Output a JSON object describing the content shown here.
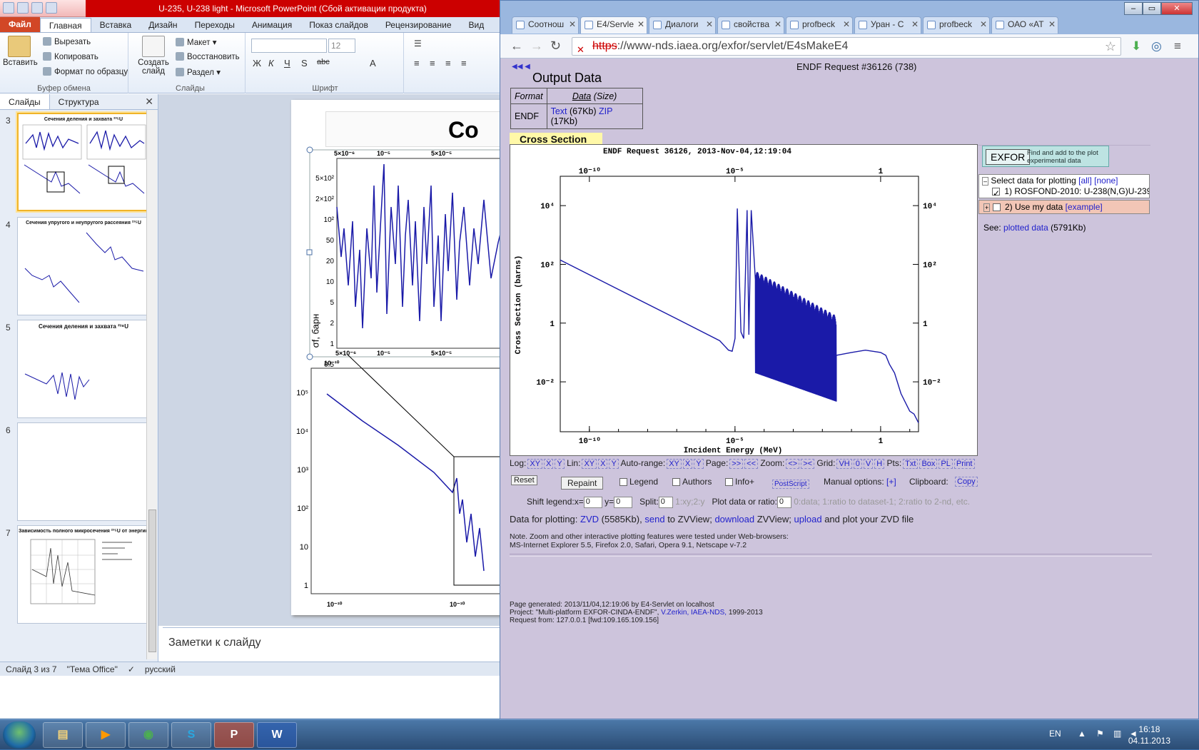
{
  "ppt": {
    "title": "U-235, U-238 light  -  Microsoft PowerPoint (Сбой активации продукта)",
    "tabs": [
      "Файл",
      "Главная",
      "Вставка",
      "Дизайн",
      "Переходы",
      "Анимация",
      "Показ слайдов",
      "Рецензирование",
      "Вид"
    ],
    "ribbon": {
      "paste": "Вставить",
      "cut": "Вырезать",
      "copy": "Копировать",
      "format_painter": "Формат по образцу",
      "clipboard_group": "Буфер обмена",
      "new_slide": "Создать слайд",
      "layout": "Макет",
      "reset": "Восстановить",
      "section": "Раздел",
      "slides_group": "Слайды",
      "font_size": "12",
      "font_group": "Шрифт"
    },
    "pane_tabs": [
      "Слайды",
      "Структура"
    ],
    "thumbs": [
      {
        "num": "3",
        "title": "Сечения деления и захвата ²³⁵U"
      },
      {
        "num": "4",
        "title": "Сечения упругого и неупругого рассеяния ²³⁵U"
      },
      {
        "num": "5",
        "title": "Сечения деления и захвата ²³⁸U"
      },
      {
        "num": "6",
        "title": ""
      },
      {
        "num": "7",
        "title": "Зависимость полного микросечения ²³⁵U от энергии"
      }
    ],
    "notes": "Заметки к слайду",
    "status": {
      "slide": "Слайд 3 из 7",
      "theme": "\"Тема Office\"",
      "lang": "русский"
    },
    "slide_axis": {
      "ylabel": "σf, барн",
      "yticks_top": [
        "5×10²",
        "2×10²",
        "10²",
        "50",
        "20",
        "10",
        "5",
        "2",
        "1",
        "0.5"
      ],
      "yticks_bottom": [
        "10⁵",
        "10⁴",
        "10³",
        "10²",
        "10",
        "1"
      ],
      "xticks": [
        "5×10⁻⁶",
        "10⁻⁵",
        "5×10⁻⁵"
      ],
      "xtick_low": "10⁻¹⁰"
    }
  },
  "chrome": {
    "tabs": [
      "Соотнош",
      "E4/Servle",
      "Диалоги",
      "свойства",
      "profbeck",
      "Уран - С",
      "profbeck",
      "ОАО «АТ"
    ],
    "url_scheme": "https",
    "url_rest": "://www-nds.iaea.org/exfor/servlet/E4sMakeE4"
  },
  "page": {
    "request_title": "ENDF Request #36126 (738)",
    "output_heading": "Output Data",
    "table": {
      "h_format": "Format",
      "h_data": "Data",
      "h_size": "(Size)",
      "format": "ENDF",
      "text_link": "Text",
      "text_size": "(67Kb)",
      "zip_link": "ZIP",
      "zip_size": "(17Kb)"
    },
    "cross_section_label": "Cross Section",
    "exfor_button": "EXFOR",
    "exfor_hint": "Find and add to the plot experimental data",
    "select_label": "Select data for plotting",
    "select_all": "[all]",
    "select_none": "[none]",
    "dataset1": "1) ROSFOND-2010: U-238(N,G)U-239",
    "use_my_data": "2) Use my data",
    "example": "[example]",
    "see": "See:",
    "plotted_data": "plotted data",
    "plotted_size": "(5791Kb)",
    "controls": {
      "log": "Log:",
      "lin": "Lin:",
      "autorange": "Auto-range:",
      "page": "Page:",
      "zoom": "Zoom:",
      "grid": "Grid:",
      "pts": "Pts:",
      "xy": "XY",
      "x": "X",
      "y": "Y",
      "next": ">>",
      "prev": "<<",
      "zin": "<>",
      "zout": "><",
      "vh": "VH",
      "zero": "0",
      "v": "V",
      "h": "H",
      "txt": "Txt",
      "box": "Box",
      "pl": "PL",
      "print": "Print",
      "reset": "Reset",
      "repaint": "Repaint",
      "legend": "Legend",
      "authors": "Authors",
      "info": "Info+",
      "postscript": "PostScript",
      "manual": "Manual options:",
      "manual_link": "[+]",
      "clipboard": "Clipboard:",
      "copy": "Copy",
      "shift_legend": "Shift legend:x=",
      "y_eq": "y=",
      "split": "Split:",
      "split_hint": "1:xy;2:y",
      "ratio": "Plot data or ratio:",
      "ratio_hint": "0:data; 1:ratio to dataset-1; 2:ratio to 2-nd, etc.",
      "shift_x": "0",
      "shift_y": "0",
      "split_val": "0",
      "ratio_val": "0"
    },
    "data_line": {
      "prefix": "Data for plotting:",
      "zvd": "ZVD",
      "zvd_size": "(5585Kb),",
      "send": "send",
      "to_zview": "to ZVView;",
      "download": "download",
      "zview": "ZVView;",
      "upload": "upload",
      "tail": "and plot your ZVD file"
    },
    "note1": "Note. Zoom and other interactive plotting features were tested under Web-browsers:",
    "note2": "MS-Internet Explorer 5.5, Firefox 2.0, Safari, Opera 9.1, Netscape v-7.2",
    "gen1": "Page generated: 2013/11/04,12:19:06 by E4-Servlet on localhost",
    "gen2_a": "Project: \"Multi-platform EXFOR-CINDA-ENDF\",",
    "gen2_b": "V.Zerkin, IAEA-NDS,",
    "gen2_c": "1999-2013",
    "gen3": "Request from: 127.0.0.1 [fwd:109.165.109.156]"
  },
  "chart_data": {
    "type": "line",
    "title": "ENDF Request 36126, 2013-Nov-04,12:19:04",
    "xlabel": "Incident Energy (MeV)",
    "ylabel": "Cross Section (barns)",
    "x_scale": "log",
    "y_scale": "log",
    "xlim": [
      1e-11,
      20
    ],
    "ylim": [
      0.0002,
      100000
    ],
    "xticks": [
      "10⁻¹⁰",
      "10⁻⁵",
      "1"
    ],
    "yticks": [
      "10⁴",
      "10²",
      "1",
      "10⁻²"
    ],
    "series": [
      {
        "name": "1) ROSFOND-2010: U-238(N,G)U-239",
        "color": "#1a1aa8",
        "x": [
          1e-11,
          1e-09,
          1e-07,
          3e-06,
          6e-06,
          8e-06,
          1e-05,
          1.2e-05,
          1.6e-05,
          2e-05,
          2.6e-05,
          3e-05,
          3.6e-05,
          5e-05,
          0.0001,
          0.0003,
          0.001,
          0.003,
          0.01,
          0.03,
          0.1,
          0.3,
          1,
          1.5,
          2,
          3,
          5,
          10,
          14,
          20
        ],
        "y": [
          140,
          14,
          1.4,
          0.25,
          0.12,
          0.11,
          0.3,
          8000,
          0.5,
          0.3,
          7000,
          0.4,
          7000,
          0.2,
          0.02,
          0.001,
          0.002,
          0.01,
          0.03,
          0.08,
          0.1,
          0.12,
          0.1,
          0.08,
          0.04,
          0.02,
          0.004,
          0.001,
          0.0008,
          0.0004
        ]
      }
    ]
  }
}
